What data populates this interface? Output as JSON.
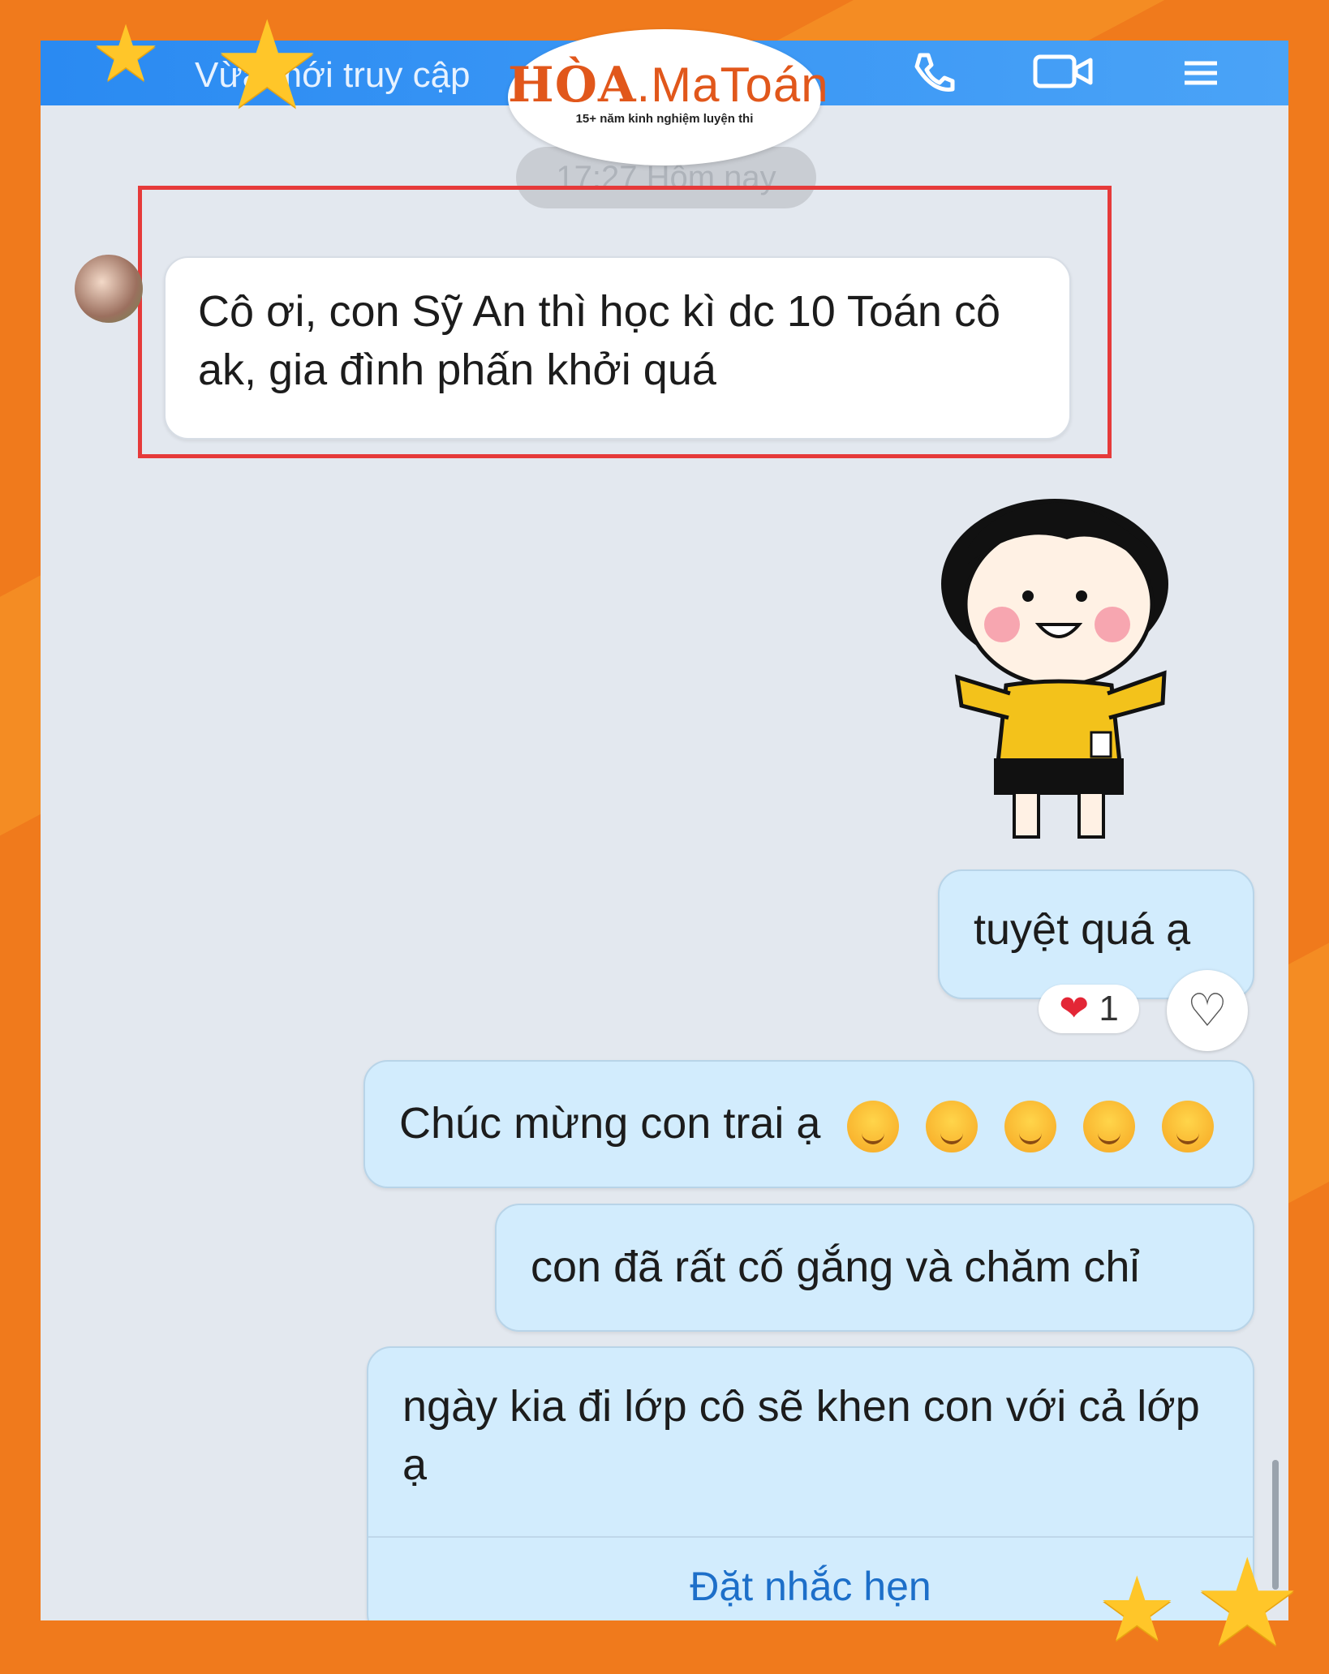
{
  "header": {
    "status_text": "Vừa mới truy cập"
  },
  "logo": {
    "brand_main": "HÒA",
    "brand_rest": ".MaToán",
    "tagline": "15+ năm kinh nghiệm luyện thi"
  },
  "timestamp": "17:27 Hôm nay",
  "messages": {
    "incoming": "Cô ơi, con Sỹ An thì học kì dc 10 Toán cô ak, gia đình phấn khởi quá",
    "out1": "tuyệt quá ạ",
    "out2": "Chúc mừng con trai ạ",
    "out3": "con đã rất cố gắng và chăm chỉ",
    "out4": "ngày kia đi lớp cô sẽ khen con với cả lớp ạ"
  },
  "reaction": {
    "emoji": "❤",
    "count": "1"
  },
  "reminder": {
    "label": "Đặt nhắc hẹn"
  },
  "colors": {
    "frame": "#f07a1c",
    "header": "#2a8af2",
    "chat_bg": "#e3e8ef",
    "highlight": "#e63a3a",
    "outgoing_bubble": "#d2ecfd"
  }
}
